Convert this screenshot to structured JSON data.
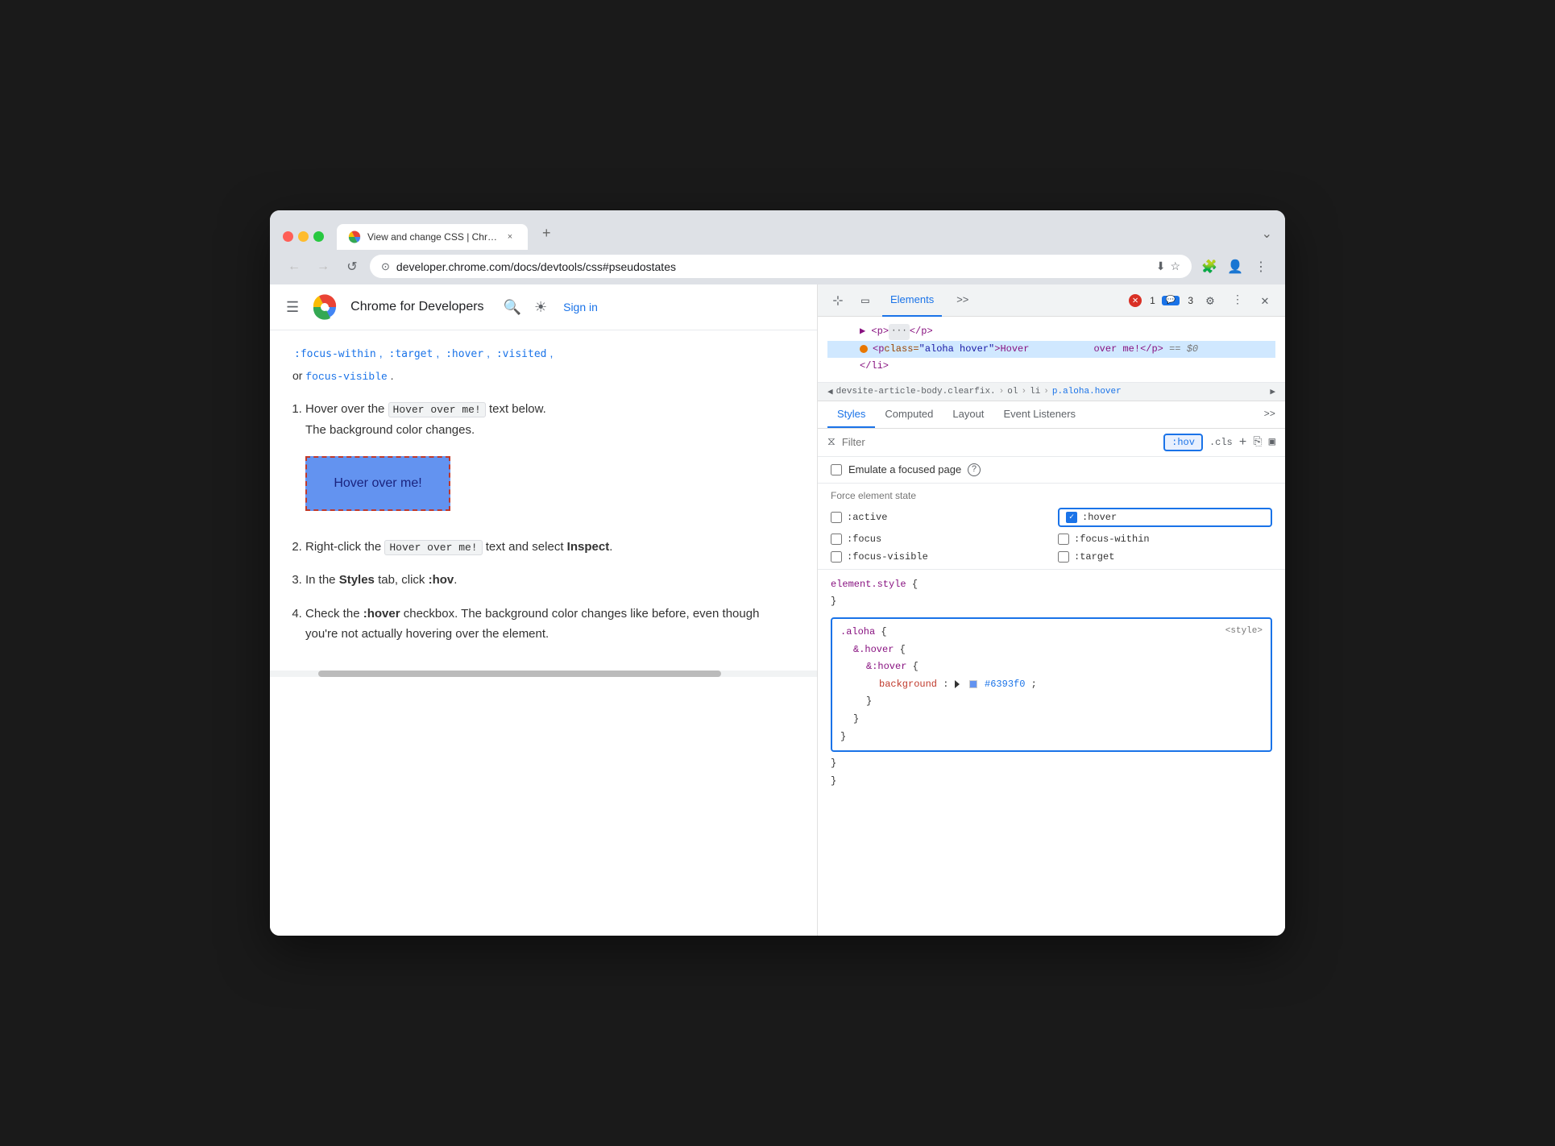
{
  "browser": {
    "tab_title": "View and change CSS | Chr…",
    "tab_close": "×",
    "tab_new": "+",
    "tab_more": "⌄",
    "url": "developer.chrome.com/docs/devtools/css#pseudostates",
    "nav": {
      "back": "←",
      "forward": "→",
      "reload": "↺"
    }
  },
  "header": {
    "site_name": "Chrome for Developers",
    "sign_in": "Sign in"
  },
  "article": {
    "top_links_text": ":focus-within, :target, :visited,",
    "focus_visible_line": "or",
    "focus_visible_link": "focus-visible",
    "focus_visible_dot": ".",
    "steps": [
      {
        "num": "1.",
        "text_before": "Hover over the",
        "code": "Hover over me!",
        "text_after": "text below. The background color changes."
      },
      {
        "num": "2.",
        "text_before": "Right-click the",
        "code": "Hover over me!",
        "text_after": "text and select",
        "bold": "Inspect",
        "text_end": "."
      },
      {
        "num": "3.",
        "text_before": "In the",
        "bold_styles": "Styles",
        "text_middle": "tab, click",
        "code2": ":hov",
        "text_after": "."
      },
      {
        "num": "4.",
        "text_before": "Check the",
        "bold": ":hover",
        "text_after": "checkbox. The background color changes like before, even though you're not actually hovering over the element."
      }
    ],
    "hover_button_label": "Hover over me!"
  },
  "devtools": {
    "tabs": [
      "Elements",
      ">>"
    ],
    "active_tab": "Elements",
    "error_count": "1",
    "warning_count": "3",
    "dom": {
      "lines": [
        {
          "indent": 1,
          "html": "▶ <p>···</p>"
        },
        {
          "indent": 1,
          "selected": true,
          "html": "<p class=\"aloha hover\">Hover over me!</p> == $0"
        },
        {
          "indent": 1,
          "html": "</li>"
        }
      ]
    },
    "breadcrumb": {
      "items": [
        "devsite-article-body.clearfix.",
        "ol",
        "li",
        "p.aloha.hover"
      ]
    },
    "style_tabs": [
      "Styles",
      "Computed",
      "Layout",
      "Event Listeners",
      ">>"
    ],
    "active_style_tab": "Styles",
    "filter_placeholder": "Filter",
    "hov_button": ":hov",
    "cls_button": ".cls",
    "emulate": {
      "label": "Emulate a focused page",
      "checked": false
    },
    "force_state": {
      "label": "Force element state",
      "states": [
        {
          "id": "active",
          "label": ":active",
          "checked": false,
          "col": 0
        },
        {
          "id": "hover",
          "label": ":hover",
          "checked": true,
          "col": 1
        },
        {
          "id": "focus",
          "label": ":focus",
          "checked": false,
          "col": 0
        },
        {
          "id": "focus-within",
          "label": ":focus-within",
          "checked": false,
          "col": 1
        },
        {
          "id": "focus-visible",
          "label": ":focus-visible",
          "checked": false,
          "col": 0
        },
        {
          "id": "target",
          "label": ":target",
          "checked": false,
          "col": 1
        }
      ]
    },
    "css_rules": [
      {
        "selector": "element.style {",
        "properties": [],
        "closing": "}"
      },
      {
        "highlighted": true,
        "source": "<style>",
        "selector": ".aloha {",
        "nested": [
          {
            "selector": "&.hover {",
            "properties": [
              {
                "nested2": true,
                "selector": "&:hover {",
                "properties": [
                  {
                    "prop": "background",
                    "value": "#6393f0",
                    "has_swatch": true
                  }
                ],
                "closing2": "}"
              }
            ],
            "closing": "}"
          }
        ],
        "closing_outer": "}"
      }
    ]
  }
}
